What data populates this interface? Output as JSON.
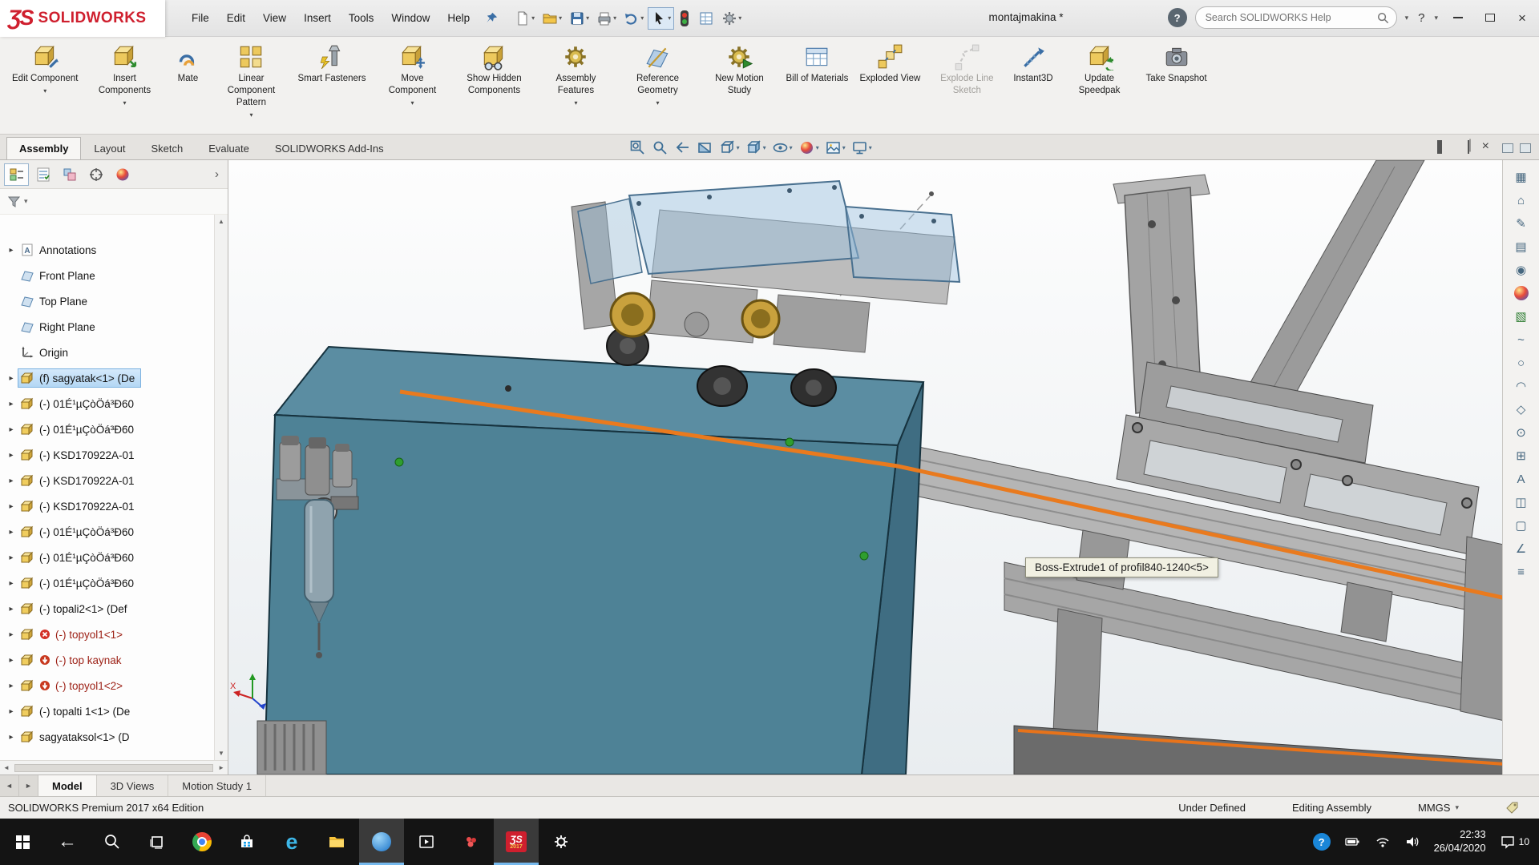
{
  "icons": {
    "caret_down": "▾",
    "chevron_right": "›",
    "expand_arrow": "▸",
    "scroll_up": "▲",
    "scroll_down": "▼",
    "scroll_left": "◄",
    "scroll_right": "►",
    "close": "×",
    "help_question": "?",
    "back_arrow": "←",
    "edge_e": "e"
  },
  "titlebar": {
    "logo_mark": "ƷS",
    "logo_text": "SOLIDWORKS",
    "menus": [
      "File",
      "Edit",
      "View",
      "Insert",
      "Tools",
      "Window",
      "Help"
    ],
    "document_title": "montajmakina *",
    "search_placeholder": "Search SOLIDWORKS Help",
    "quick_access": [
      "new-document",
      "open",
      "save",
      "print",
      "undo",
      "select-cursor",
      "selection-filter",
      "evaluate-grid",
      "options-gear"
    ]
  },
  "ribbon": {
    "buttons": [
      {
        "label": "Edit Component",
        "icon": "edit-component",
        "dropdown": true,
        "enabled": true
      },
      {
        "label": "Insert Components",
        "icon": "insert-components",
        "dropdown": true,
        "enabled": true
      },
      {
        "label": "Mate",
        "icon": "mate",
        "dropdown": false,
        "enabled": true
      },
      {
        "label": "Linear Component Pattern",
        "icon": "linear-component-pattern",
        "dropdown": true,
        "enabled": true
      },
      {
        "label": "Smart Fasteners",
        "icon": "smart-fasteners",
        "dropdown": false,
        "enabled": true
      },
      {
        "label": "Move Component",
        "icon": "move-component",
        "dropdown": true,
        "enabled": true
      },
      {
        "label": "Show Hidden Components",
        "icon": "show-hidden-components",
        "dropdown": false,
        "enabled": true
      },
      {
        "label": "Assembly Features",
        "icon": "assembly-features",
        "dropdown": true,
        "enabled": true
      },
      {
        "label": "Reference Geometry",
        "icon": "reference-geometry",
        "dropdown": true,
        "enabled": true
      },
      {
        "label": "New Motion Study",
        "icon": "new-motion-study",
        "dropdown": false,
        "enabled": true
      },
      {
        "label": "Bill of Materials",
        "icon": "bill-of-materials",
        "dropdown": false,
        "enabled": true
      },
      {
        "label": "Exploded View",
        "icon": "exploded-view",
        "dropdown": false,
        "enabled": true
      },
      {
        "label": "Explode Line Sketch",
        "icon": "explode-line-sketch",
        "dropdown": false,
        "enabled": false
      },
      {
        "label": "Instant3D",
        "icon": "instant3d",
        "dropdown": false,
        "enabled": true
      },
      {
        "label": "Update Speedpak",
        "icon": "update-speedpak",
        "dropdown": false,
        "enabled": true
      },
      {
        "label": "Take Snapshot",
        "icon": "take-snapshot",
        "dropdown": false,
        "enabled": true
      }
    ]
  },
  "command_tabs": {
    "tabs": [
      "Assembly",
      "Layout",
      "Sketch",
      "Evaluate",
      "SOLIDWORKS Add-Ins"
    ],
    "active": "Assembly"
  },
  "heads_up": {
    "buttons": [
      "zoom-to-fit",
      "zoom-to-area",
      "previous-view",
      "section-view",
      "view-orientation",
      "display-style",
      "hide-show-items",
      "edit-appearance",
      "apply-scene",
      "view-settings"
    ]
  },
  "feature_tree": {
    "panel_tabs": [
      "featuremanager-tree",
      "propertymanager",
      "configurationmanager",
      "dimxpertmanager",
      "displaymanager"
    ],
    "items": [
      {
        "label": "Annotations",
        "icon": "annotations",
        "arrow": true
      },
      {
        "label": "Front Plane",
        "icon": "plane",
        "arrow": false
      },
      {
        "label": "Top Plane",
        "icon": "plane",
        "arrow": false
      },
      {
        "label": "Right Plane",
        "icon": "plane",
        "arrow": false
      },
      {
        "label": "Origin",
        "icon": "origin",
        "arrow": false
      },
      {
        "label": "(f) sagyatak<1> (De",
        "icon": "component",
        "arrow": true,
        "selected": true
      },
      {
        "label": "(-) 01É¹µÇòÖá³Ð60",
        "icon": "component",
        "arrow": true
      },
      {
        "label": "(-) 01É¹µÇòÖá³Ð60",
        "icon": "component",
        "arrow": true
      },
      {
        "label": "(-) KSD170922A-01",
        "icon": "component",
        "arrow": true
      },
      {
        "label": "(-) KSD170922A-01",
        "icon": "component",
        "arrow": true
      },
      {
        "label": "(-) KSD170922A-01",
        "icon": "component",
        "arrow": true
      },
      {
        "label": "(-) 01É¹µÇòÖá³Ð60",
        "icon": "component",
        "arrow": true
      },
      {
        "label": "(-) 01É¹µÇòÖá³Ð60",
        "icon": "component",
        "arrow": true
      },
      {
        "label": "(-) 01É¹µÇòÖá³Ð60",
        "icon": "component",
        "arrow": true
      },
      {
        "label": "(-) topali2<1> (Def",
        "icon": "component",
        "arrow": true
      },
      {
        "label": "(-) topyol1<1>",
        "icon": "component",
        "arrow": true,
        "badge": "error"
      },
      {
        "label": "(-) top kaynak",
        "icon": "component",
        "arrow": true,
        "badge": "stop"
      },
      {
        "label": "(-) topyol1<2>",
        "icon": "component",
        "arrow": true,
        "badge": "stop"
      },
      {
        "label": "(-) topalti 1<1> (De",
        "icon": "component",
        "arrow": true
      },
      {
        "label": "sagyataksol<1> (D",
        "icon": "component",
        "arrow": true
      }
    ]
  },
  "viewport": {
    "tooltip": "Boss-Extrude1 of profil840-1240<5>"
  },
  "right_toolbar": {
    "icons": [
      {
        "name": "options-grid-icon",
        "glyph": "▦"
      },
      {
        "name": "home-icon",
        "glyph": "⌂"
      },
      {
        "name": "sketch-pencil-icon",
        "glyph": "✎"
      },
      {
        "name": "design-library-icon",
        "glyph": "▤"
      },
      {
        "name": "target-icon",
        "glyph": "◉"
      },
      {
        "name": "scene-icon",
        "glyph": "▧"
      },
      {
        "name": "spline-icon",
        "glyph": "~"
      },
      {
        "name": "circle-icon",
        "glyph": "○"
      },
      {
        "name": "arc-icon",
        "glyph": "◠"
      },
      {
        "name": "polygon-icon",
        "glyph": "◇"
      },
      {
        "name": "point-icon",
        "glyph": "⊙"
      },
      {
        "name": "pattern-icon",
        "glyph": "⊞"
      },
      {
        "name": "text-icon",
        "glyph": "A"
      },
      {
        "name": "mirror-icon",
        "glyph": "◫"
      },
      {
        "name": "cube-icon",
        "glyph": "▢"
      },
      {
        "name": "measure-icon",
        "glyph": "∠"
      },
      {
        "name": "section-list-icon",
        "glyph": "≡"
      }
    ]
  },
  "bottom_tabs": {
    "tabs": [
      "Model",
      "3D Views",
      "Motion Study 1"
    ],
    "active": "Model"
  },
  "status_bar": {
    "left": "SOLIDWORKS Premium 2017 x64 Edition",
    "right": [
      "Under Defined",
      "Editing Assembly",
      "MMGS"
    ]
  },
  "taskbar": {
    "apps": [
      "chrome",
      "store",
      "edge",
      "file-explorer",
      "browser-active",
      "movies-tv",
      "media",
      "solidworks",
      "settings"
    ],
    "sw_mark": "ƷS",
    "sw_badge": "2017",
    "time": "22:33",
    "date": "26/04/2020",
    "notification_count": "10"
  }
}
